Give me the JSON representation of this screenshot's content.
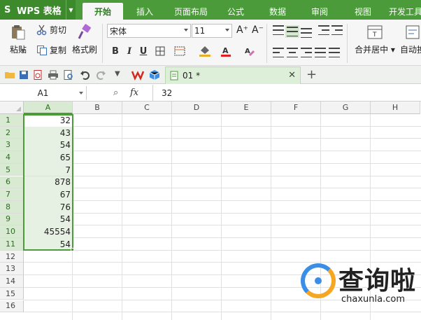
{
  "app": {
    "logo": "S",
    "title": "WPS 表格"
  },
  "tabs": [
    "开始",
    "插入",
    "页面布局",
    "公式",
    "数据",
    "审阅",
    "视图",
    "开发工具"
  ],
  "active_tab": "开始",
  "ribbon": {
    "paste": "粘贴",
    "cut": "剪切",
    "copy": "复制",
    "format_painter": "格式刷",
    "font_name": "宋体",
    "font_size": "11",
    "bold": "B",
    "italic": "I",
    "underline": "U",
    "increase_font": "A⁺",
    "decrease_font": "A⁻",
    "merge_center": "合并居中",
    "auto_wrap": "自动换"
  },
  "document_tab": {
    "name": "01 *"
  },
  "formula_bar": {
    "cell_ref": "A1",
    "fx": "fx",
    "value": "32"
  },
  "columns": [
    "A",
    "B",
    "C",
    "D",
    "E",
    "F",
    "G",
    "H"
  ],
  "selected_column": "A",
  "rows": [
    "1",
    "2",
    "3",
    "4",
    "5",
    "6",
    "7",
    "8",
    "9",
    "10",
    "11",
    "12",
    "13",
    "14",
    "15",
    "16"
  ],
  "column_a_values": [
    "32",
    "43",
    "54",
    "65",
    "7",
    "878",
    "67",
    "76",
    "54",
    "45554",
    "54"
  ],
  "watermark": {
    "text": "查询啦",
    "url": "chaxunla.com"
  },
  "colors": {
    "accent": "#4b9b3a",
    "selection_fill": "#e7f1e3",
    "header_selected": "#d8ead2"
  }
}
